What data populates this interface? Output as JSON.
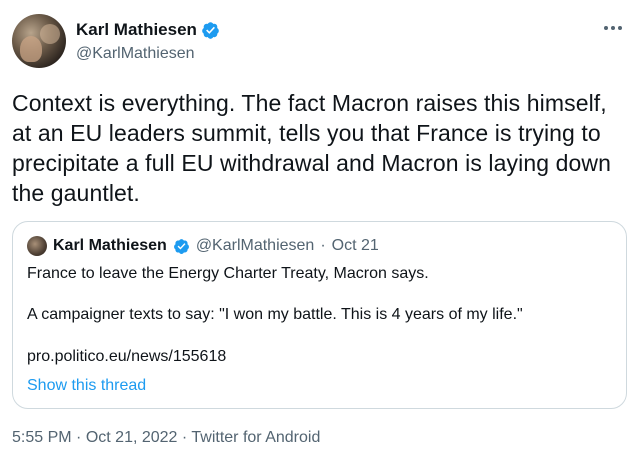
{
  "tweet": {
    "author_name": "Karl Mathiesen",
    "author_handle": "@KarlMathiesen",
    "text": "Context is everything. The fact Macron raises this himself, at an EU leaders summit, tells you that France is trying to precipitate a full EU withdrawal and Macron is laying down the gauntlet.",
    "time": "5:55 PM",
    "date": "Oct 21, 2022",
    "source": "Twitter for Android",
    "separator": "·"
  },
  "quote": {
    "author_name": "Karl Mathiesen",
    "author_handle": "@KarlMathiesen",
    "separator": "·",
    "date": "Oct 21",
    "line1": "France to leave the Energy Charter Treaty, Macron says.",
    "line2": "A campaigner texts to say: \"I won my battle. This is 4 years of my life.\"",
    "line3": "pro.politico.eu/news/155618",
    "show_thread": "Show this thread"
  },
  "colors": {
    "text": "#0f1419",
    "secondary": "#536471",
    "link": "#1d9bf0",
    "verified": "#1d9bf0",
    "border": "#cfd9de"
  },
  "icons": [
    "verified-badge-icon",
    "more-options-icon"
  ]
}
